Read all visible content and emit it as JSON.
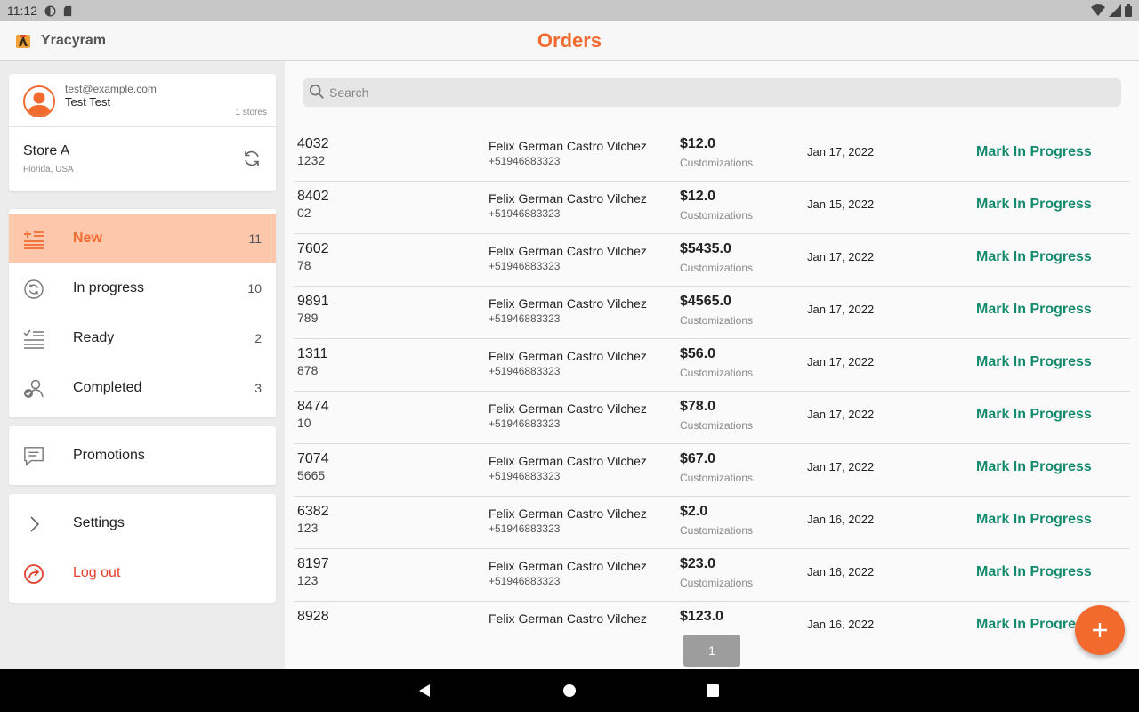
{
  "status_bar": {
    "time": "11:12"
  },
  "app": {
    "name": "Yracyram",
    "title": "Orders",
    "accent": "#f26a2e",
    "action_color": "#138a6d",
    "danger_color": "#e2402f"
  },
  "account": {
    "email": "test@example.com",
    "name": "Test Test",
    "stores_count": "1 stores",
    "store_name": "Store A",
    "store_location": "Florida, USA"
  },
  "nav": {
    "statuses": [
      {
        "label": "New",
        "count": "11",
        "icon": "new-orders-icon"
      },
      {
        "label": "In progress",
        "count": "10",
        "icon": "sync-icon"
      },
      {
        "label": "Ready",
        "count": "2",
        "icon": "checklist-icon"
      },
      {
        "label": "Completed",
        "count": "3",
        "icon": "user-check-icon"
      }
    ],
    "promotions": "Promotions",
    "settings": "Settings",
    "logout": "Log out"
  },
  "search": {
    "placeholder": "Search",
    "value": ""
  },
  "orders": [
    {
      "number": "4032",
      "sub": "1232",
      "customer": "Felix German Castro Vilchez",
      "phone": "+51946883323",
      "price": "$12.0",
      "customizations": "Customizations",
      "date": "Jan 17, 2022",
      "action": "Mark In Progress"
    },
    {
      "number": "8402",
      "sub": "02",
      "customer": "Felix German Castro Vilchez",
      "phone": "+51946883323",
      "price": "$12.0",
      "customizations": "Customizations",
      "date": "Jan 15, 2022",
      "action": "Mark In Progress"
    },
    {
      "number": "7602",
      "sub": "78",
      "customer": "Felix German Castro Vilchez",
      "phone": "+51946883323",
      "price": "$5435.0",
      "customizations": "Customizations",
      "date": "Jan 17, 2022",
      "action": "Mark In Progress"
    },
    {
      "number": "9891",
      "sub": "789",
      "customer": "Felix German Castro Vilchez",
      "phone": "+51946883323",
      "price": "$4565.0",
      "customizations": "Customizations",
      "date": "Jan 17, 2022",
      "action": "Mark In Progress"
    },
    {
      "number": "1311",
      "sub": "878",
      "customer": "Felix German Castro Vilchez",
      "phone": "+51946883323",
      "price": "$56.0",
      "customizations": "Customizations",
      "date": "Jan 17, 2022",
      "action": "Mark In Progress"
    },
    {
      "number": "8474",
      "sub": "10",
      "customer": "Felix German Castro Vilchez",
      "phone": "+51946883323",
      "price": "$78.0",
      "customizations": "Customizations",
      "date": "Jan 17, 2022",
      "action": "Mark In Progress"
    },
    {
      "number": "7074",
      "sub": "5665",
      "customer": "Felix German Castro Vilchez",
      "phone": "+51946883323",
      "price": "$67.0",
      "customizations": "Customizations",
      "date": "Jan 17, 2022",
      "action": "Mark In Progress"
    },
    {
      "number": "6382",
      "sub": "123",
      "customer": "Felix German Castro Vilchez",
      "phone": "+51946883323",
      "price": "$2.0",
      "customizations": "Customizations",
      "date": "Jan 16, 2022",
      "action": "Mark In Progress"
    },
    {
      "number": "8197",
      "sub": "123",
      "customer": "Felix German Castro Vilchez",
      "phone": "+51946883323",
      "price": "$23.0",
      "customizations": "Customizations",
      "date": "Jan 16, 2022",
      "action": "Mark In Progress"
    },
    {
      "number": "8928",
      "sub": "",
      "customer": "Felix German Castro Vilchez",
      "phone": "",
      "price": "$123.0",
      "customizations": "",
      "date": "Jan 16, 2022",
      "action": "Mark In Progress"
    }
  ],
  "pagination": {
    "current_page": "1"
  }
}
